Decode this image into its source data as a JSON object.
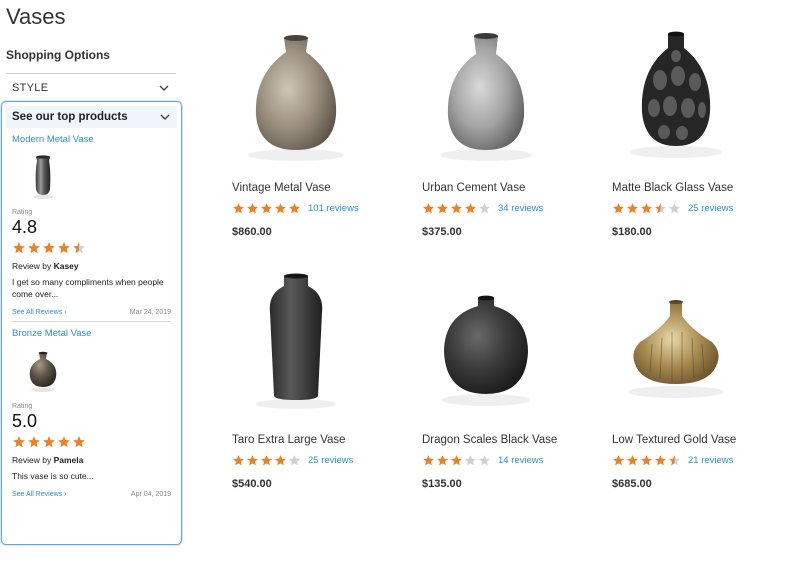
{
  "page": {
    "title": "Vases"
  },
  "sidebar": {
    "options_title": "Shopping Options",
    "style_label": "STYLE",
    "top_products": {
      "header": "See our top products",
      "items": [
        {
          "name": "Modern Metal Vase",
          "rating_label": "Rating",
          "rating_value": "4.8",
          "stars": 4.5,
          "review_by_prefix": "Review by",
          "reviewer": "Kasey",
          "review_text": "I get so many compliments when people come over...",
          "see_all": "See All Reviews",
          "date": "Mar 24, 2019"
        },
        {
          "name": "Bronze Metal Vase",
          "rating_label": "Rating",
          "rating_value": "5.0",
          "stars": 5,
          "review_by_prefix": "Review by",
          "reviewer": "Pamela",
          "review_text": "This vase is so cute...",
          "see_all": "See All Reviews",
          "date": "Apr 04, 2019"
        }
      ]
    }
  },
  "products": [
    {
      "name": "Vintage Metal Vase",
      "stars": 5,
      "reviews": "101 reviews",
      "price": "$860.00"
    },
    {
      "name": "Urban Cement Vase",
      "stars": 4,
      "reviews": "34 reviews",
      "price": "$375.00"
    },
    {
      "name": "Matte Black Glass Vase",
      "stars": 3.5,
      "reviews": "25 reviews",
      "price": "$180.00"
    },
    {
      "name": "Taro Extra Large Vase",
      "stars": 4,
      "reviews": "25 reviews",
      "price": "$540.00"
    },
    {
      "name": "Dragon Scales Black Vase",
      "stars": 3,
      "reviews": "14 reviews",
      "price": "$135.00"
    },
    {
      "name": "Low Textured Gold Vase",
      "stars": 4.5,
      "reviews": "21 reviews",
      "price": "$685.00"
    }
  ],
  "colors": {
    "star": "#e8832a",
    "star_empty": "#d0d0d0",
    "link": "#2b8fcf",
    "panel_border": "#6aa7d6"
  }
}
